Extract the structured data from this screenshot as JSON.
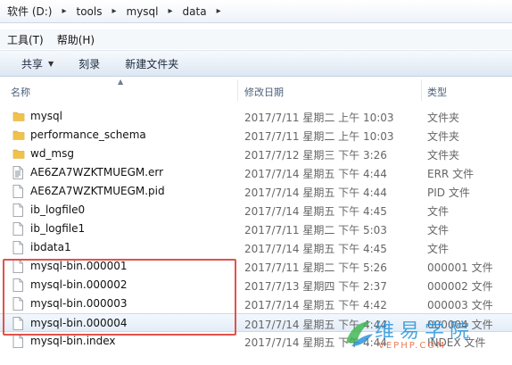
{
  "breadcrumb": [
    "软件 (D:)",
    "tools",
    "mysql",
    "data"
  ],
  "menu": [
    "工具(T)",
    "帮助(H)"
  ],
  "toolbar": {
    "share": "共享",
    "burn": "刻录",
    "new_folder": "新建文件夹"
  },
  "columns": {
    "name": "名称",
    "modified": "修改日期",
    "type": "类型"
  },
  "files": [
    {
      "name": "mysql",
      "date": "2017/7/11 星期二 上午 10:03",
      "type": "文件夹",
      "icon": "folder-icon"
    },
    {
      "name": "performance_schema",
      "date": "2017/7/11 星期二 上午 10:03",
      "type": "文件夹",
      "icon": "folder-icon"
    },
    {
      "name": "wd_msg",
      "date": "2017/7/12 星期三 下午 3:26",
      "type": "文件夹",
      "icon": "folder-icon"
    },
    {
      "name": "AE6ZA7WZKTMUEGM.err",
      "date": "2017/7/14 星期五 下午 4:44",
      "type": "ERR 文件",
      "icon": "text-file-icon"
    },
    {
      "name": "AE6ZA7WZKTMUEGM.pid",
      "date": "2017/7/14 星期五 下午 4:44",
      "type": "PID 文件",
      "icon": "file-icon"
    },
    {
      "name": "ib_logfile0",
      "date": "2017/7/14 星期五 下午 4:45",
      "type": "文件",
      "icon": "file-icon"
    },
    {
      "name": "ib_logfile1",
      "date": "2017/7/11 星期二 下午 5:03",
      "type": "文件",
      "icon": "file-icon"
    },
    {
      "name": "ibdata1",
      "date": "2017/7/14 星期五 下午 4:45",
      "type": "文件",
      "icon": "file-icon"
    },
    {
      "name": "mysql-bin.000001",
      "date": "2017/7/11 星期二 下午 5:26",
      "type": "000001 文件",
      "icon": "file-icon"
    },
    {
      "name": "mysql-bin.000002",
      "date": "2017/7/13 星期四 下午 2:37",
      "type": "000002 文件",
      "icon": "file-icon"
    },
    {
      "name": "mysql-bin.000003",
      "date": "2017/7/14 星期五 下午 4:42",
      "type": "000003 文件",
      "icon": "file-icon"
    },
    {
      "name": "mysql-bin.000004",
      "date": "2017/7/14 星期五 下午 4:44",
      "type": "000004 文件",
      "icon": "file-icon"
    },
    {
      "name": "mysql-bin.index",
      "date": "2017/7/14 星期五 下午 4:44",
      "type": "INDEX 文件",
      "icon": "file-icon"
    }
  ],
  "selected_index": 11,
  "watermark": {
    "main": "维易学院",
    "sub": "VEPHP.COM"
  },
  "colors": {
    "folder": "#f0c24a",
    "highlight": "#e0534a",
    "accent": "#1f8fd8"
  }
}
